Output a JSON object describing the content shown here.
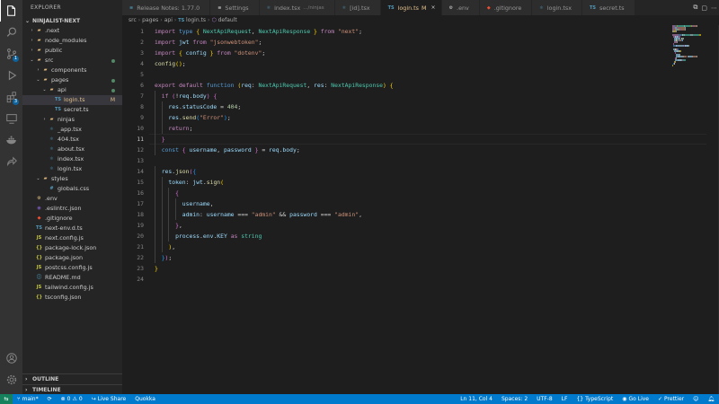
{
  "explorer": {
    "title": "EXPLORER",
    "project": "NINJALIST-NEXT",
    "tree": [
      {
        "label": ".next",
        "type": "folder",
        "depth": 1,
        "open": false
      },
      {
        "label": "node_modules",
        "type": "folder",
        "depth": 1,
        "open": false
      },
      {
        "label": "public",
        "type": "folder",
        "depth": 1,
        "open": false
      },
      {
        "label": "src",
        "type": "folder",
        "depth": 1,
        "open": true,
        "dot": true
      },
      {
        "label": "components",
        "type": "folder",
        "depth": 2,
        "open": false
      },
      {
        "label": "pages",
        "type": "folder",
        "depth": 2,
        "open": true,
        "dot": true
      },
      {
        "label": "api",
        "type": "folder",
        "depth": 3,
        "open": true,
        "dot": true
      },
      {
        "label": "login.ts",
        "type": "ts",
        "depth": 4,
        "selected": true,
        "mod": "M"
      },
      {
        "label": "secret.ts",
        "type": "ts",
        "depth": 4
      },
      {
        "label": "ninjas",
        "type": "folder",
        "depth": 3,
        "open": false
      },
      {
        "label": "_app.tsx",
        "type": "tsx",
        "depth": 3
      },
      {
        "label": "404.tsx",
        "type": "tsx",
        "depth": 3
      },
      {
        "label": "about.tsx",
        "type": "tsx",
        "depth": 3
      },
      {
        "label": "index.tsx",
        "type": "tsx",
        "depth": 3
      },
      {
        "label": "login.tsx",
        "type": "tsx",
        "depth": 3
      },
      {
        "label": "styles",
        "type": "folder",
        "depth": 2,
        "open": true
      },
      {
        "label": "globals.css",
        "type": "css",
        "depth": 3
      },
      {
        "label": ".env",
        "type": "env",
        "depth": 1
      },
      {
        "label": ".eslintrc.json",
        "type": "eslint",
        "depth": 1
      },
      {
        "label": ".gitignore",
        "type": "git",
        "depth": 1
      },
      {
        "label": "next-env.d.ts",
        "type": "ts",
        "depth": 1
      },
      {
        "label": "next.config.js",
        "type": "js",
        "depth": 1
      },
      {
        "label": "package-lock.json",
        "type": "json",
        "depth": 1
      },
      {
        "label": "package.json",
        "type": "json",
        "depth": 1
      },
      {
        "label": "postcss.config.js",
        "type": "js",
        "depth": 1
      },
      {
        "label": "README.md",
        "type": "md",
        "depth": 1
      },
      {
        "label": "tailwind.config.js",
        "type": "js",
        "depth": 1
      },
      {
        "label": "tsconfig.json",
        "type": "json",
        "depth": 1
      }
    ],
    "outline": "OUTLINE",
    "timeline": "TIMELINE"
  },
  "tabs": [
    {
      "label": "Release Notes: 1.77.0",
      "icon": "≡",
      "color": "#519aba"
    },
    {
      "label": "Settings",
      "icon": "≡",
      "color": "#cccccc"
    },
    {
      "label": "index.tsx",
      "desc": ".../ninjas",
      "icon": "⚛",
      "color": "#519aba"
    },
    {
      "label": "[id].tsx",
      "icon": "⚛",
      "color": "#519aba"
    },
    {
      "label": "login.ts",
      "mod": "M",
      "icon": "TS",
      "color": "#519aba",
      "active": true
    },
    {
      "label": ".env",
      "icon": "⚙",
      "color": "#cccccc"
    },
    {
      "label": ".gitignore",
      "icon": "◆",
      "color": "#f14e32"
    },
    {
      "label": "login.tsx",
      "icon": "⚛",
      "color": "#519aba"
    },
    {
      "label": "secret.ts",
      "icon": "TS",
      "color": "#519aba"
    }
  ],
  "breadcrumb": [
    "src",
    "pages",
    "api",
    "login.ts",
    "default"
  ],
  "code": [
    [
      [
        "import ",
        "kw2"
      ],
      [
        "type ",
        "kw"
      ],
      [
        "{ ",
        "br1"
      ],
      [
        "NextApiRequest",
        "ty"
      ],
      [
        ", ",
        "pl"
      ],
      [
        "NextApiResponse",
        "ty"
      ],
      [
        " }",
        "br1"
      ],
      [
        " from ",
        "kw2"
      ],
      [
        "\"next\"",
        "str"
      ],
      [
        ";",
        "pl"
      ]
    ],
    [
      [
        "import ",
        "kw2"
      ],
      [
        "jwt ",
        "vr"
      ],
      [
        "from ",
        "kw2"
      ],
      [
        "\"jsonwebtoken\"",
        "str"
      ],
      [
        ";",
        "pl"
      ]
    ],
    [
      [
        "import ",
        "kw2"
      ],
      [
        "{ ",
        "br1"
      ],
      [
        "config ",
        "vr"
      ],
      [
        "}",
        "br1"
      ],
      [
        " from ",
        "kw2"
      ],
      [
        "\"dotenv\"",
        "str"
      ],
      [
        ";",
        "pl"
      ]
    ],
    [
      [
        "config",
        "fn"
      ],
      [
        "()",
        "br1"
      ],
      [
        ";",
        "pl"
      ]
    ],
    [],
    [
      [
        "export ",
        "kw2"
      ],
      [
        "default ",
        "kw2"
      ],
      [
        "function ",
        "kw"
      ],
      [
        "(",
        "br1"
      ],
      [
        "req",
        "vr"
      ],
      [
        ": ",
        "pl"
      ],
      [
        "NextApiRequest",
        "ty"
      ],
      [
        ", ",
        "pl"
      ],
      [
        "res",
        "vr"
      ],
      [
        ": ",
        "pl"
      ],
      [
        "NextApiResponse",
        "ty"
      ],
      [
        ") ",
        "br1"
      ],
      [
        "{",
        "br1"
      ]
    ],
    [
      [
        "  if ",
        "kw2"
      ],
      [
        "(",
        "br2"
      ],
      [
        "!",
        "pl"
      ],
      [
        "req",
        "vr"
      ],
      [
        ".",
        "pl"
      ],
      [
        "body",
        "vr"
      ],
      [
        ") ",
        "br2"
      ],
      [
        "{",
        "br2"
      ]
    ],
    [
      [
        "    res",
        "vr"
      ],
      [
        ".",
        "pl"
      ],
      [
        "statusCode",
        "vr"
      ],
      [
        " = ",
        "pl"
      ],
      [
        "404",
        "num"
      ],
      [
        ";",
        "pl"
      ]
    ],
    [
      [
        "    res",
        "vr"
      ],
      [
        ".",
        "pl"
      ],
      [
        "send",
        "fn"
      ],
      [
        "(",
        "br3"
      ],
      [
        "\"Error\"",
        "str"
      ],
      [
        ")",
        "br3"
      ],
      [
        ";",
        "pl"
      ]
    ],
    [
      [
        "    return",
        "kw2"
      ],
      [
        ";",
        "pl"
      ]
    ],
    [
      [
        "  }",
        "br2"
      ]
    ],
    [
      [
        "  const ",
        "kw"
      ],
      [
        "{ ",
        "br2"
      ],
      [
        "username",
        "vr"
      ],
      [
        ", ",
        "pl"
      ],
      [
        "password ",
        "vr"
      ],
      [
        "}",
        "br2"
      ],
      [
        " = ",
        "pl"
      ],
      [
        "req",
        "vr"
      ],
      [
        ".",
        "pl"
      ],
      [
        "body",
        "vr"
      ],
      [
        ";",
        "pl"
      ]
    ],
    [],
    [
      [
        "  res",
        "vr"
      ],
      [
        ".",
        "pl"
      ],
      [
        "json",
        "fn"
      ],
      [
        "(",
        "br2"
      ],
      [
        "{",
        "br3"
      ]
    ],
    [
      [
        "    token",
        "vr"
      ],
      [
        ": ",
        "pl"
      ],
      [
        "jwt",
        "vr"
      ],
      [
        ".",
        "pl"
      ],
      [
        "sign",
        "fn"
      ],
      [
        "(",
        "br1"
      ]
    ],
    [
      [
        "      {",
        "br2"
      ]
    ],
    [
      [
        "        username",
        "vr"
      ],
      [
        ",",
        "pl"
      ]
    ],
    [
      [
        "        admin",
        "vr"
      ],
      [
        ": ",
        "pl"
      ],
      [
        "username ",
        "vr"
      ],
      [
        "=== ",
        "pl"
      ],
      [
        "\"admin\"",
        "str"
      ],
      [
        " && ",
        "pl"
      ],
      [
        "password ",
        "vr"
      ],
      [
        "=== ",
        "pl"
      ],
      [
        "\"admin\"",
        "str"
      ],
      [
        ",",
        "pl"
      ]
    ],
    [
      [
        "      }",
        "br2"
      ],
      [
        ",",
        "pl"
      ]
    ],
    [
      [
        "      process",
        "vr"
      ],
      [
        ".",
        "pl"
      ],
      [
        "env",
        "vr"
      ],
      [
        ".",
        "pl"
      ],
      [
        "KEY ",
        "vr"
      ],
      [
        "as ",
        "kw2"
      ],
      [
        "string",
        "ty"
      ]
    ],
    [
      [
        "    )",
        "br1"
      ],
      [
        ",",
        "pl"
      ]
    ],
    [
      [
        "  }",
        "br3"
      ],
      [
        ")",
        "br2"
      ],
      [
        ";",
        "pl"
      ]
    ],
    [
      [
        "}",
        "br1"
      ]
    ],
    []
  ],
  "current_line": 11,
  "status": {
    "branch": "main*",
    "errors": "0",
    "warnings": "0",
    "live_share": "Live Share",
    "quokka": "Quokka",
    "position": "Ln 11, Col 4",
    "spaces": "Spaces: 2",
    "encoding": "UTF-8",
    "eol": "LF",
    "language": "TypeScript",
    "go_live": "Go Live",
    "prettier": "Prettier"
  },
  "colors": {
    "accent": "#007acc",
    "remote": "#16825d",
    "ts_icon": "#519aba",
    "folder_icon": "#dcb67a",
    "modified": "#e2c08d"
  }
}
